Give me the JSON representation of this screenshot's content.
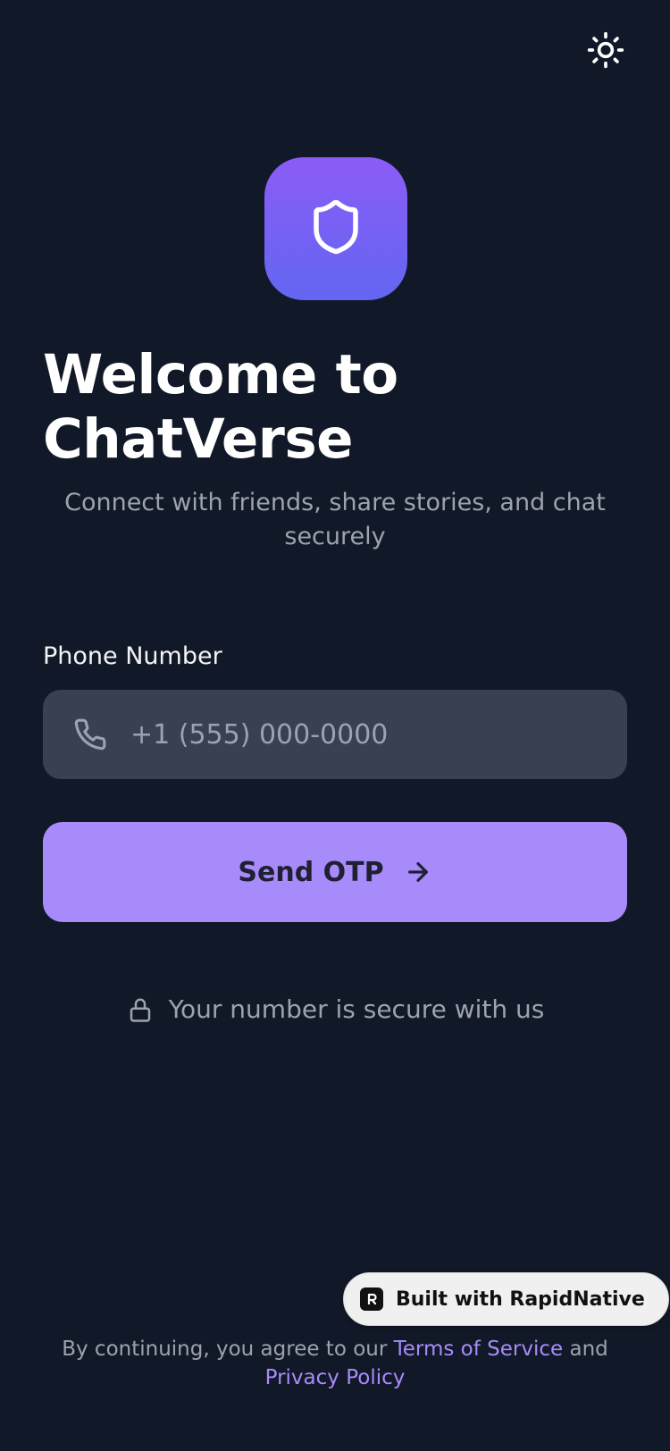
{
  "header": {
    "theme_icon": "sun-icon"
  },
  "logo": {
    "icon": "shield-icon",
    "gradient_start": "#8b5cf6",
    "gradient_end": "#6366f1"
  },
  "welcome": {
    "title_line1": "Welcome to",
    "title_line2": "ChatVerse",
    "subtitle": "Connect with friends, share stories, and chat securely"
  },
  "form": {
    "phone_label": "Phone Number",
    "phone_placeholder": "+1 (555) 000-0000",
    "phone_value": "",
    "phone_icon": "phone-icon",
    "send_button_label": "Send OTP",
    "send_button_icon": "arrow-right-icon",
    "send_button_color": "#a78bfa"
  },
  "security": {
    "icon": "lock-icon",
    "text": "Your number is secure with us"
  },
  "badge": {
    "icon": "rapidnative-logo-icon",
    "text": "Built with RapidNative"
  },
  "legal": {
    "prefix": "By continuing, you agree to our ",
    "terms_label": "Terms of Service",
    "conjunction": " and ",
    "privacy_label": "Privacy Policy"
  },
  "colors": {
    "background": "#111827",
    "input_background": "#374151",
    "accent": "#a78bfa",
    "muted_text": "#9ca3af"
  }
}
